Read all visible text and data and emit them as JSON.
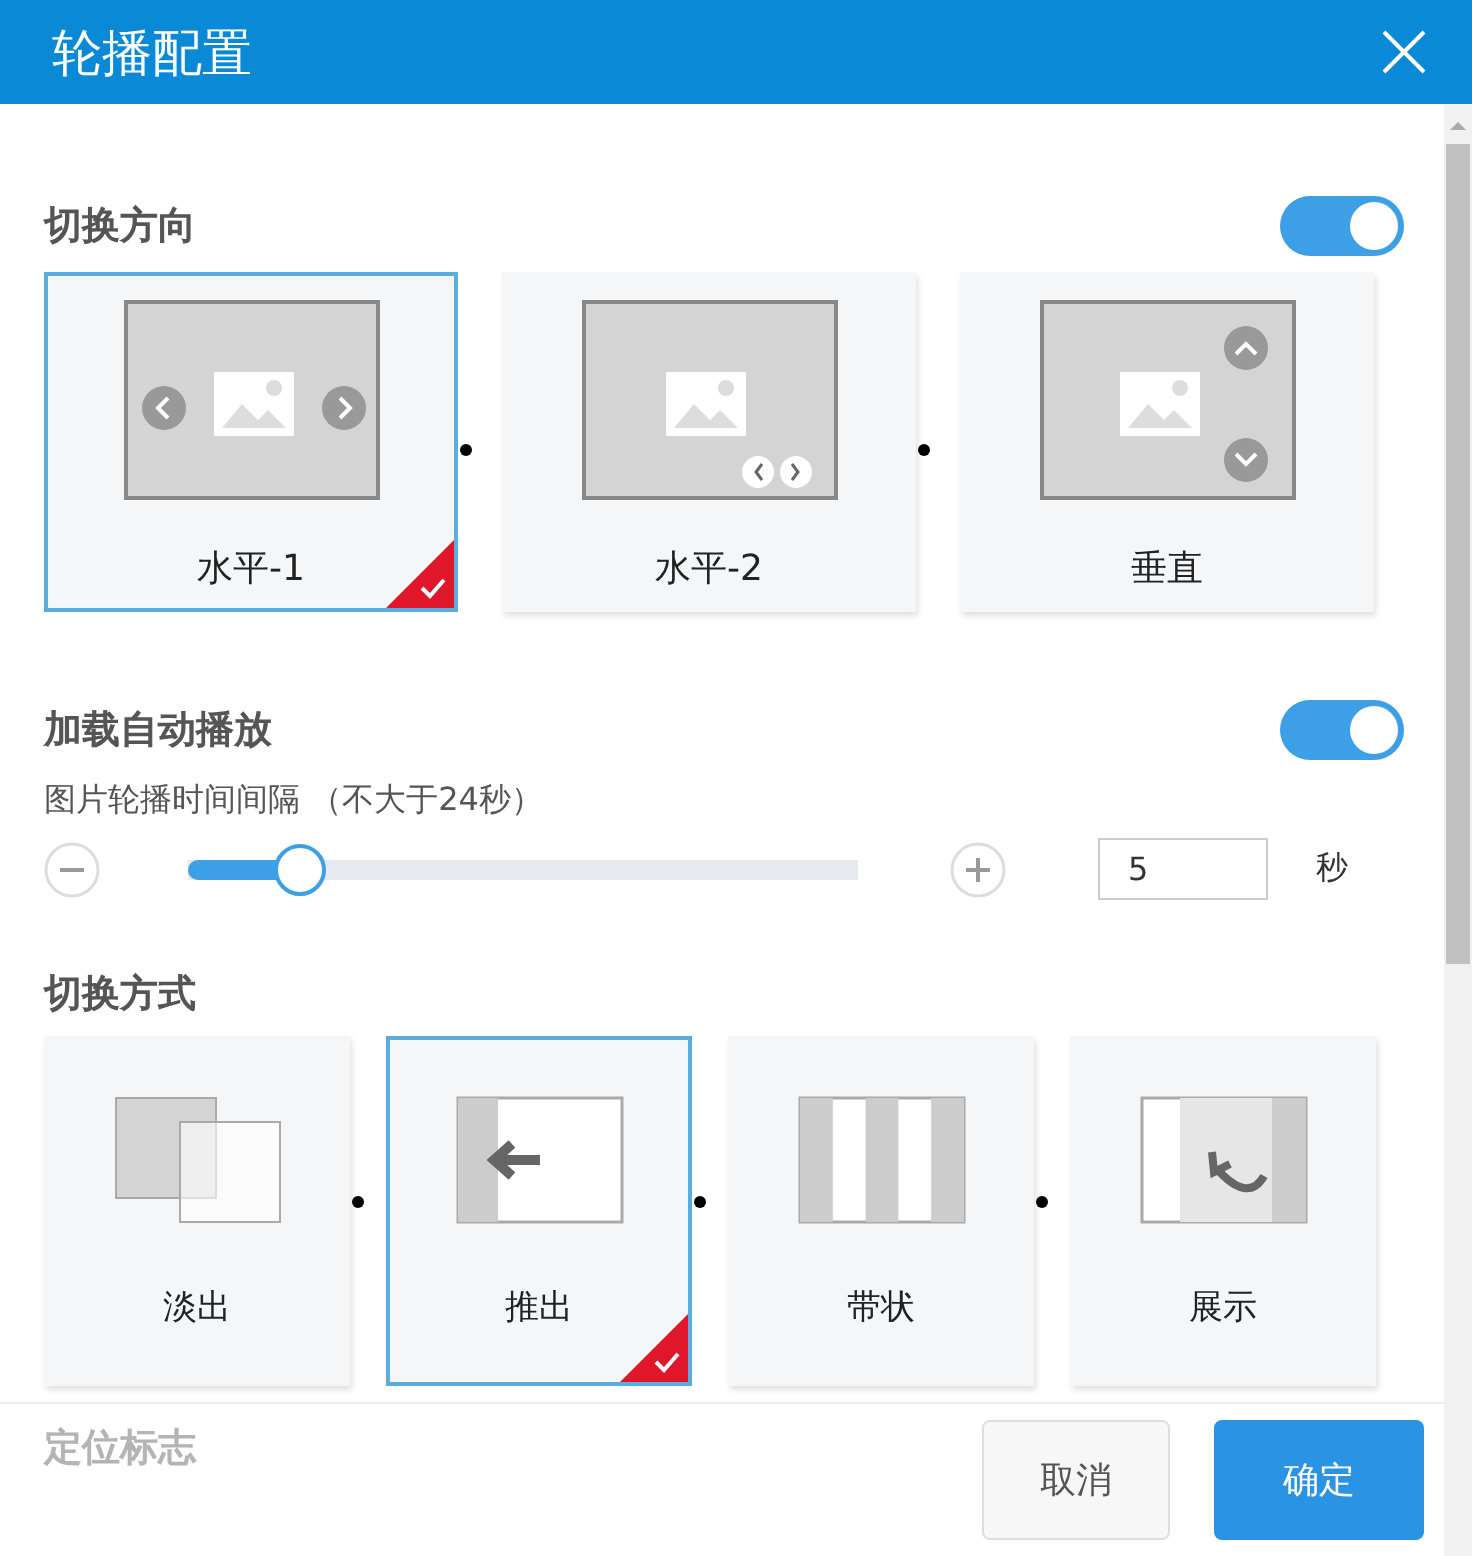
{
  "window": {
    "title": "轮播配置"
  },
  "direction": {
    "title": "切换方向",
    "on": true,
    "options": [
      {
        "label": "水平-1",
        "selected": true,
        "kind": "side"
      },
      {
        "label": "水平-2",
        "selected": false,
        "kind": "corner"
      },
      {
        "label": "垂直",
        "selected": false,
        "kind": "vertical"
      }
    ]
  },
  "autoplay": {
    "title": "加载自动播放",
    "on": true,
    "interval_label": "图片轮播时间间隔 （不大于24秒）",
    "level": 0.17,
    "value": "5",
    "unit": "秒"
  },
  "transition": {
    "title": "切换方式",
    "options": [
      {
        "label": "淡出",
        "selected": false,
        "kind": "fade"
      },
      {
        "label": "推出",
        "selected": true,
        "kind": "push"
      },
      {
        "label": "带状",
        "selected": false,
        "kind": "stripes"
      },
      {
        "label": "展示",
        "selected": false,
        "kind": "reveal"
      }
    ]
  },
  "next_section": {
    "title": "定位标志"
  },
  "buttons": [
    {
      "label": "取消",
      "kind": "secondary"
    },
    {
      "label": "确定",
      "kind": "primary"
    }
  ]
}
